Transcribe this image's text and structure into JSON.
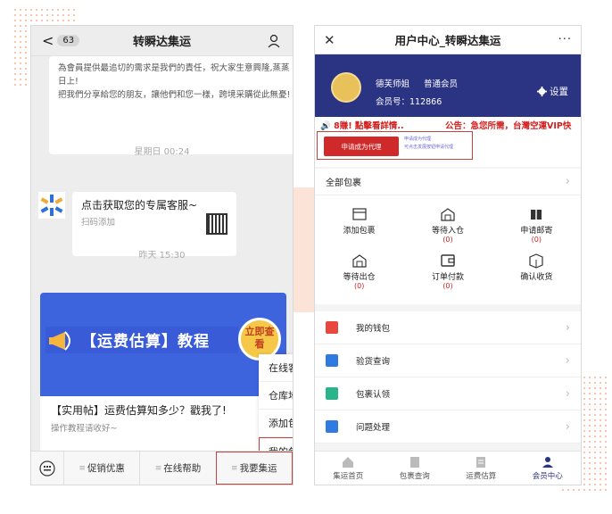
{
  "left_chat": {
    "back_glyph": "<",
    "unread_count": "63",
    "title": "转瞬达集运",
    "message_top": {
      "lines": [
        "為會員提供最追切的需求是我們的責任，祝大家生意興隆,蒸蒸日上!",
        "把我們分享給您的朋友，讓他們和您一樣，跨境采購從此無憂!"
      ]
    },
    "time_1": "星期日 00:24",
    "service_card": {
      "title": "点击获取您的专属客服~",
      "subtitle": "扫码添加"
    },
    "time_2": "昨天 15:30",
    "article_card": {
      "banner_text": "【运费估算】教程",
      "banner_button": "立即查看",
      "title": "【实用帖】运费估算知多少？戳我了!",
      "subtitle": "操作教程请收好~"
    },
    "popup_menu": [
      {
        "label": "在线客服",
        "highlight": false
      },
      {
        "label": "仓库地址",
        "highlight": false
      },
      {
        "label": "添加包裹",
        "highlight": false
      },
      {
        "label": "我的包裹",
        "highlight": true
      }
    ],
    "bottom_menu": [
      {
        "label": "促销优惠",
        "highlight": false
      },
      {
        "label": "在线帮助",
        "highlight": false
      },
      {
        "label": "我要集运",
        "highlight": true
      }
    ]
  },
  "right_app": {
    "title": "用户中心_转瞬达集运",
    "close_glyph": "✕",
    "more_glyph": "···",
    "user": {
      "name": "德芙师姐",
      "level": "普通会员",
      "member_no": "会员号：112866"
    },
    "settings_label": "设置",
    "marquee": {
      "left": "🔊 8賺! 點擊看詳情..",
      "right": "公告：急您所需，台灣空運VIP快"
    },
    "agent": {
      "button": "申请成为代理",
      "note_line1": "申请成为代理",
      "note_line2": "可点击发展按钮申请代理"
    },
    "all_packages_label": "全部包裹",
    "package_grid": [
      {
        "label": "添加包裹",
        "count": "",
        "icon": "add-package-icon"
      },
      {
        "label": "等待入仓",
        "count": "(0)",
        "icon": "warehouse-in-icon"
      },
      {
        "label": "申请邮寄",
        "count": "(0)",
        "icon": "mail-request-icon"
      },
      {
        "label": "等待出仓",
        "count": "(0)",
        "icon": "warehouse-out-icon"
      },
      {
        "label": "订单付款",
        "count": "(0)",
        "icon": "payment-icon"
      },
      {
        "label": "确认收货",
        "count": "",
        "icon": "confirm-receipt-icon"
      }
    ],
    "list_items": [
      {
        "label": "我的钱包",
        "color": "#e8473d",
        "icon": "wallet-icon"
      },
      {
        "label": "验货查询",
        "color": "#2f7be0",
        "icon": "inspection-icon"
      },
      {
        "label": "包裹认领",
        "color": "#2bb38b",
        "icon": "claim-icon"
      },
      {
        "label": "问题处理",
        "color": "#2f7be0",
        "icon": "issue-icon"
      }
    ],
    "tabs": [
      {
        "label": "集运首页",
        "icon": "home-icon",
        "active": false
      },
      {
        "label": "包裹查询",
        "icon": "package-search-icon",
        "active": false
      },
      {
        "label": "运费估算",
        "icon": "freight-estimate-icon",
        "active": false
      },
      {
        "label": "会员中心",
        "icon": "member-center-icon",
        "active": true
      }
    ]
  },
  "colors": {
    "brand_navy": "#2b3383",
    "highlight_red": "#c2453d",
    "banner_blue": "#3d63dd"
  }
}
